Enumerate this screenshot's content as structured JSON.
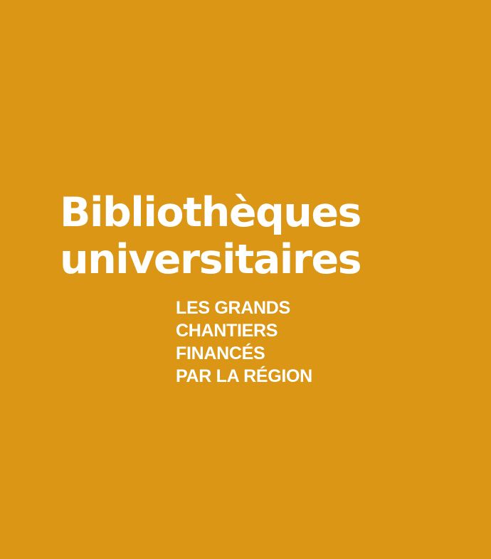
{
  "colors": {
    "background": "#DA9614",
    "text": "#FFFFFF"
  },
  "title": {
    "line1": "Bibliothèques",
    "line2": "universitaires"
  },
  "subtitle": {
    "line1": "LES GRANDS",
    "line2": "CHANTIERS",
    "line3": "FINANCÉS",
    "line4": "PAR LA RÉGION"
  }
}
